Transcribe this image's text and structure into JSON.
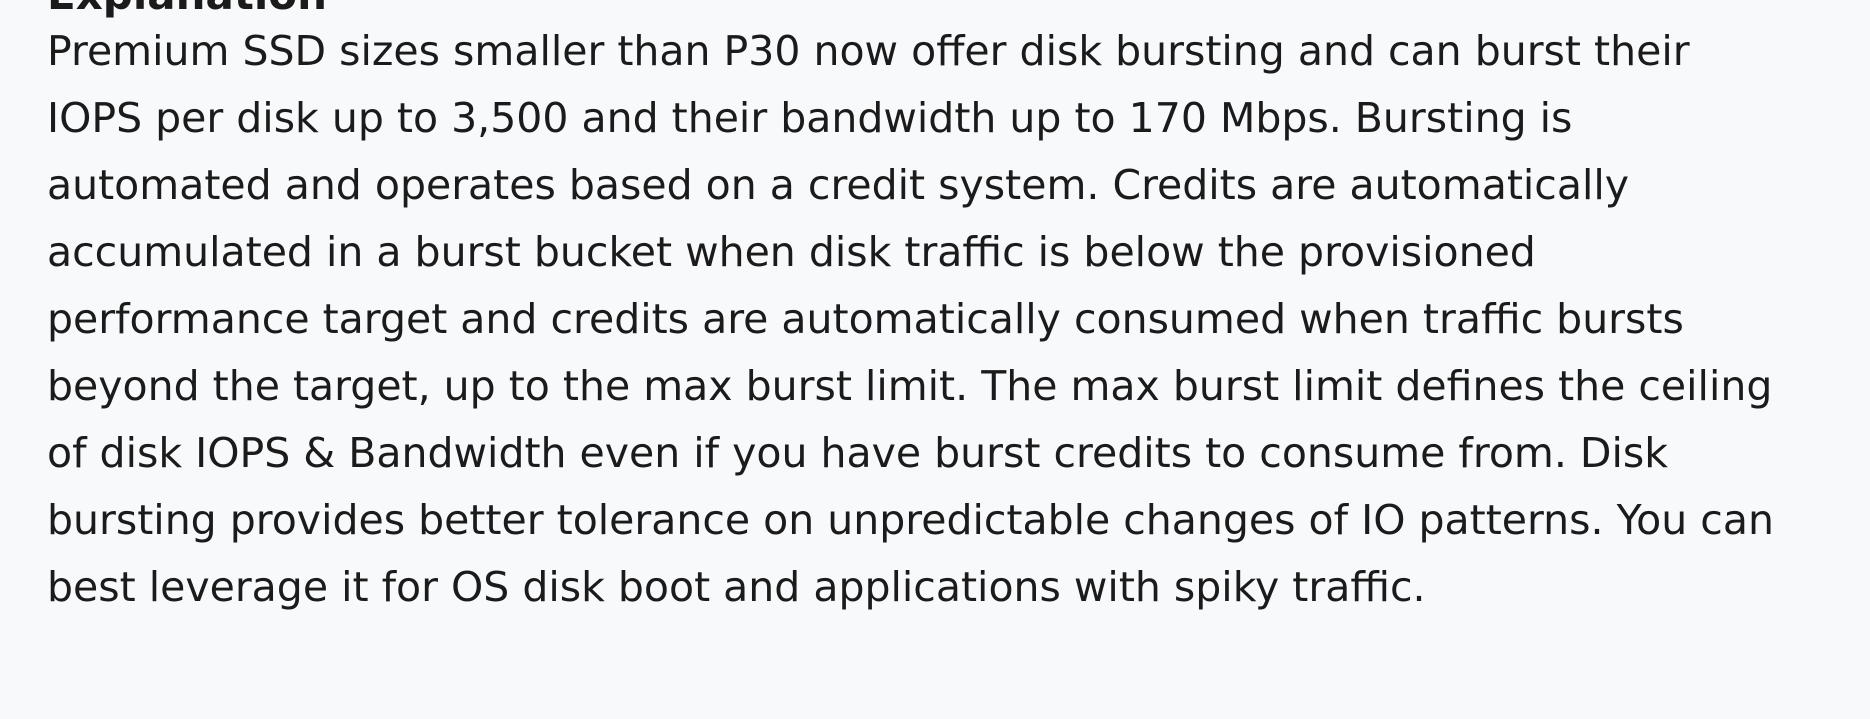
{
  "section": {
    "heading": "Explanation"
  },
  "explanation": {
    "lines": [
      "Premium SSD sizes smaller than P30 now offer disk bursting and can burst their",
      "IOPS per disk up to 3,500 and their bandwidth up to 170 Mbps. Bursting is",
      "automated and operates based on a credit system. Credits are automatically",
      "accumulated in a burst bucket when disk traffic is below the provisioned",
      "performance target and credits are automatically consumed when traffic bursts",
      "beyond the target, up to the max burst limit. The max burst limit defines the ceiling",
      "of disk IOPS & Bandwidth even if you have burst credits to consume from. Disk",
      "bursting provides better tolerance on unpredictable changes of IO patterns. You can",
      "best leverage it for OS disk boot and applications with spiky traffic."
    ]
  }
}
